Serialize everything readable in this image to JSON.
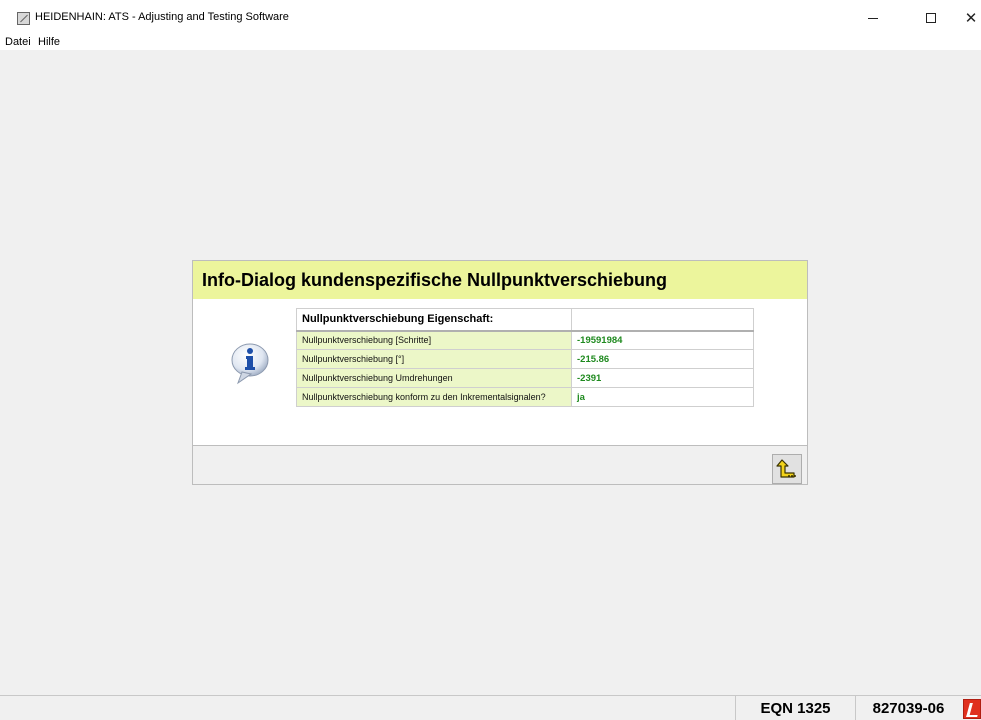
{
  "window": {
    "title": "HEIDENHAIN: ATS - Adjusting and Testing Software",
    "icons": {
      "app": "heidenhain-app-icon",
      "minimize": "minimize-icon",
      "maximize": "maximize-icon",
      "close": "close-icon"
    }
  },
  "menu": {
    "items": [
      {
        "label": "Datei"
      },
      {
        "label": "Hilfe"
      }
    ]
  },
  "dialog": {
    "title": "Info-Dialog kundenspezifische Nullpunktverschiebung",
    "header_color": "#ecf59c",
    "info_icon": "info-speech-bubble-icon",
    "table": {
      "columns": [
        "Nullpunktverschiebung Eigenschaft:",
        ""
      ],
      "rows": [
        {
          "name": "Nullpunktverschiebung [Schritte]",
          "value": "-19591984"
        },
        {
          "name": "Nullpunktverschiebung [°]",
          "value": "-215.86"
        },
        {
          "name": "Nullpunktverschiebung Umdrehungen",
          "value": "-2391"
        },
        {
          "name": "Nullpunktverschiebung konform zu den Inkrementalsignalen?",
          "value": "ja"
        }
      ],
      "value_color": "#1f8a1f",
      "name_bg_color": "#ecf7c8"
    },
    "back_button_icon": "return-arrow-icon"
  },
  "status": {
    "device": "EQN 1325",
    "id": "827039-06",
    "indicator_icon": "connection-status-icon",
    "indicator_color": "#e0301e"
  }
}
